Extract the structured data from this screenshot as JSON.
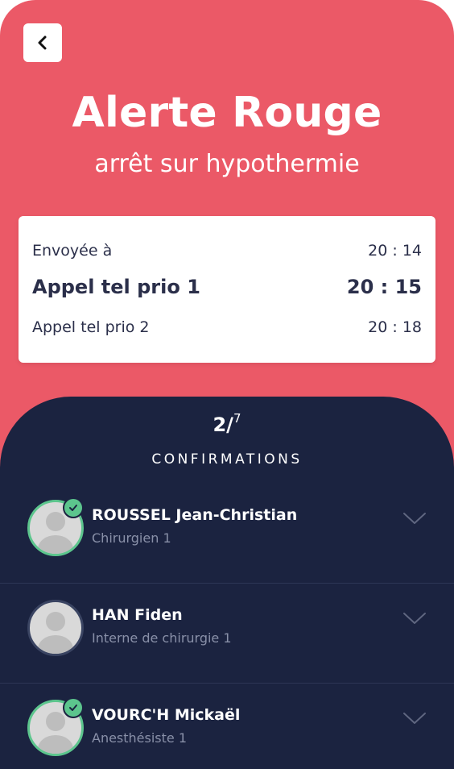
{
  "header": {
    "title": "Alerte Rouge",
    "subtitle": "arrêt sur hypothermie"
  },
  "card": {
    "sent": {
      "label": "Envoyée à",
      "time": "20 : 14"
    },
    "prio1": {
      "label": "Appel tel prio 1",
      "time": "20 : 15"
    },
    "prio2": {
      "label": "Appel tel prio 2",
      "time": "20 : 18"
    }
  },
  "confirmations": {
    "count": "2/",
    "total": "7",
    "label": "CONFIRMATIONS"
  },
  "people": [
    {
      "name": "ROUSSEL Jean-Christian",
      "role": "Chirurgien 1",
      "confirmed": true
    },
    {
      "name": "HAN Fiden",
      "role": "Interne de chirurgie 1",
      "confirmed": false
    },
    {
      "name": "VOURC'H Mickaël",
      "role": "Anesthésiste 1",
      "confirmed": true
    }
  ],
  "colors": {
    "alert_red": "#eb5967",
    "navy": "#1b2340",
    "confirmed_green": "#5cc58d"
  },
  "icons": [
    "chevron-left-icon",
    "check-icon",
    "chevron-down-icon",
    "avatar-placeholder"
  ]
}
